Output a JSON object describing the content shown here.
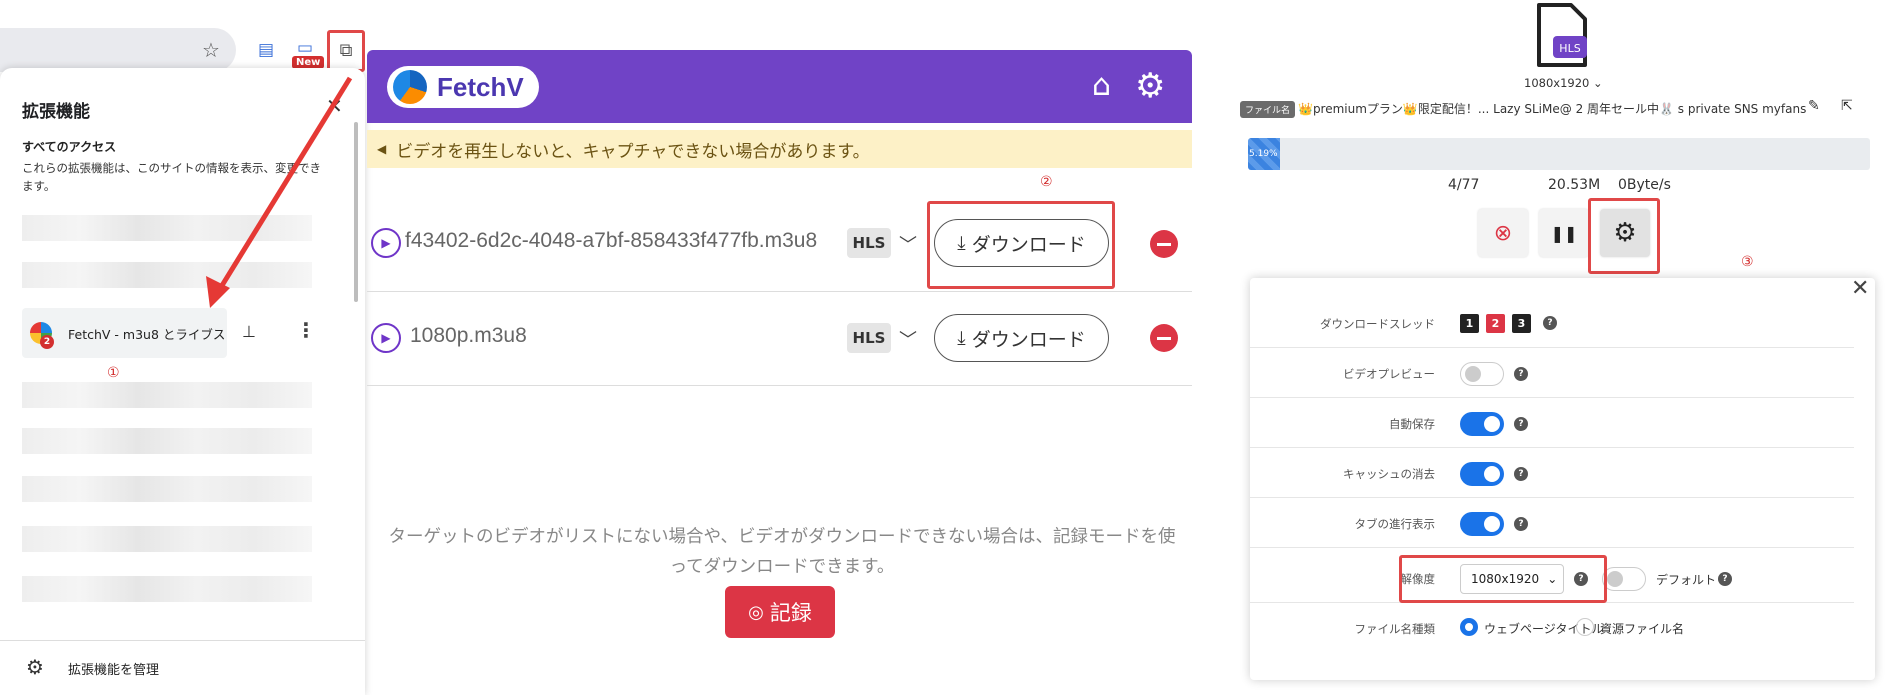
{
  "panel1": {
    "menu_title": "拡張機能",
    "access_title": "すべてのアクセス",
    "access_desc": "これらの拡張機能は、このサイトの情報を表示、変更できます。",
    "new_badge": "New",
    "extension_label": "FetchV - m3u8 とライブス...",
    "extension_badge": "2",
    "step_marker": "①",
    "manage_label": "拡張機能を管理",
    "icons": [
      "star-icon",
      "reading-list-icon",
      "puzzle-icon",
      "close-icon",
      "pin-icon",
      "more-vert-icon",
      "gear-icon"
    ]
  },
  "panel2": {
    "brand": "FetchV",
    "notice": "ビデオを再生しないと、キャプチャできない場合があります。",
    "step_marker": "②",
    "items": [
      {
        "name": "f43402-6d2c-4048-a7bf-858433f477fb.m3u8",
        "tag": "HLS",
        "download_label": "ダウンロード"
      },
      {
        "name": "1080p.m3u8",
        "tag": "HLS",
        "download_label": "ダウンロード"
      }
    ],
    "hint": "ターゲットのビデオがリストにない場合や、ビデオがダウンロードできない場合は、記録モードを使ってダウンロードできます。",
    "record_label": "記録",
    "colors": {
      "header": "#7043c6",
      "notice": "#fdf1c7",
      "danger": "#dc3545"
    }
  },
  "panel3": {
    "file_type": "HLS",
    "resolution_selector": "1080x1920",
    "filename_tag": "ファイル名",
    "filename": "👑premiumプラン👑限定配信！... Lazy SLiMe@ 2 周年セール中🐰 s private SNS myfans",
    "progress_label": "5.19%",
    "progress_fraction": 0.0519,
    "segments": "4/77",
    "size": "20.53M",
    "speed": "0Byte/s",
    "step_marker": "③",
    "settings": {
      "thread_label": "ダウンロードスレッド",
      "threads": [
        "1",
        "2",
        "3"
      ],
      "preview_label": "ビデオプレビュー",
      "autosave_label": "自動保存",
      "clear_cache_label": "キャッシュの消去",
      "tab_progress_label": "タブの進行表示",
      "resolution_label": "解像度",
      "resolution_value": "1080x1920",
      "default_label": "デフォルト",
      "filename_type_label": "ファイル名種類",
      "opt_webpage_title": "ウェブページタイトル",
      "opt_source_name": "資源ファイル名"
    }
  }
}
